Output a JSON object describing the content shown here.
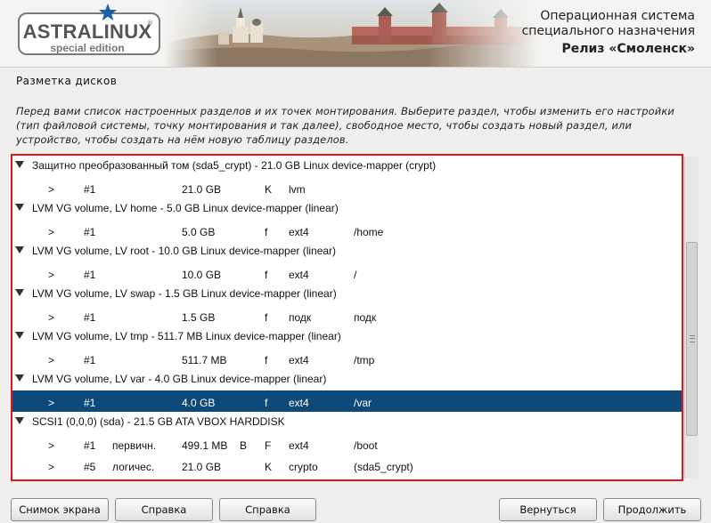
{
  "header": {
    "logo_name": "ASTRALINUX",
    "logo_registered": "®",
    "logo_edition": "special edition",
    "product_line1": "Операционная система",
    "product_line2": "специального назначения",
    "release": "Релиз «Смоленск»"
  },
  "step": {
    "title": "Разметка дисков",
    "instructions": "Перед вами список настроенных разделов и их точек монтирования. Выберите раздел, чтобы изменить его настройки (тип файловой системы, точку монтирования и так далее), свободное место, чтобы создать новый раздел, или устройство, чтобы создать на нём новую таблицу разделов."
  },
  "partitions": [
    {
      "type": "device",
      "label": "Защитно преобразованный том (sda5_crypt) - 21.0 GB Linux device-mapper (crypt)"
    },
    {
      "type": "part",
      "arrow": ">",
      "num": "#1",
      "kind": "",
      "size": "21.0 GB",
      "flag1": "",
      "flag2": "K",
      "fs": "lvm",
      "mount": ""
    },
    {
      "type": "device",
      "label": "LVM VG volume, LV home - 5.0 GB Linux device-mapper (linear)"
    },
    {
      "type": "part",
      "arrow": ">",
      "num": "#1",
      "kind": "",
      "size": "5.0 GB",
      "flag1": "",
      "flag2": "f",
      "fs": "ext4",
      "mount": "/home"
    },
    {
      "type": "device",
      "label": "LVM VG volume, LV root - 10.0 GB Linux device-mapper (linear)"
    },
    {
      "type": "part",
      "arrow": ">",
      "num": "#1",
      "kind": "",
      "size": "10.0 GB",
      "flag1": "",
      "flag2": "f",
      "fs": "ext4",
      "mount": "/"
    },
    {
      "type": "device",
      "label": "LVM VG volume, LV swap - 1.5 GB Linux device-mapper (linear)"
    },
    {
      "type": "part",
      "arrow": ">",
      "num": "#1",
      "kind": "",
      "size": "1.5 GB",
      "flag1": "",
      "flag2": "f",
      "fs": "подк",
      "mount": "подк"
    },
    {
      "type": "device",
      "label": "LVM VG volume, LV tmp - 511.7 MB Linux device-mapper (linear)"
    },
    {
      "type": "part",
      "arrow": ">",
      "num": "#1",
      "kind": "",
      "size": "511.7 MB",
      "flag1": "",
      "flag2": "f",
      "fs": "ext4",
      "mount": "/tmp"
    },
    {
      "type": "device",
      "label": "LVM VG volume, LV var - 4.0 GB Linux device-mapper (linear)"
    },
    {
      "type": "part",
      "arrow": ">",
      "num": "#1",
      "kind": "",
      "size": "4.0 GB",
      "flag1": "",
      "flag2": "f",
      "fs": "ext4",
      "mount": "/var",
      "selected": true
    },
    {
      "type": "device",
      "label": "SCSI1 (0,0,0) (sda) - 21.5 GB ATA VBOX HARDDISK"
    },
    {
      "type": "part",
      "arrow": ">",
      "num": "#1",
      "kind": "первичн.",
      "size": "499.1 MB",
      "flag1": "B",
      "flag2": "F",
      "fs": "ext4",
      "mount": "/boot"
    },
    {
      "type": "part",
      "arrow": ">",
      "num": "#5",
      "kind": "логичес.",
      "size": "21.0 GB",
      "flag1": "",
      "flag2": "K",
      "fs": "crypto",
      "mount": "(sda5_crypt)"
    }
  ],
  "buttons": {
    "screenshot": "Снимок экрана",
    "help1": "Справка",
    "help2": "Справка",
    "back": "Вернуться",
    "continue": "Продолжить"
  },
  "colors": {
    "selection": "#0d4a7a",
    "highlight_border": "#e0151f",
    "logo_star": "#1d5fa8"
  }
}
